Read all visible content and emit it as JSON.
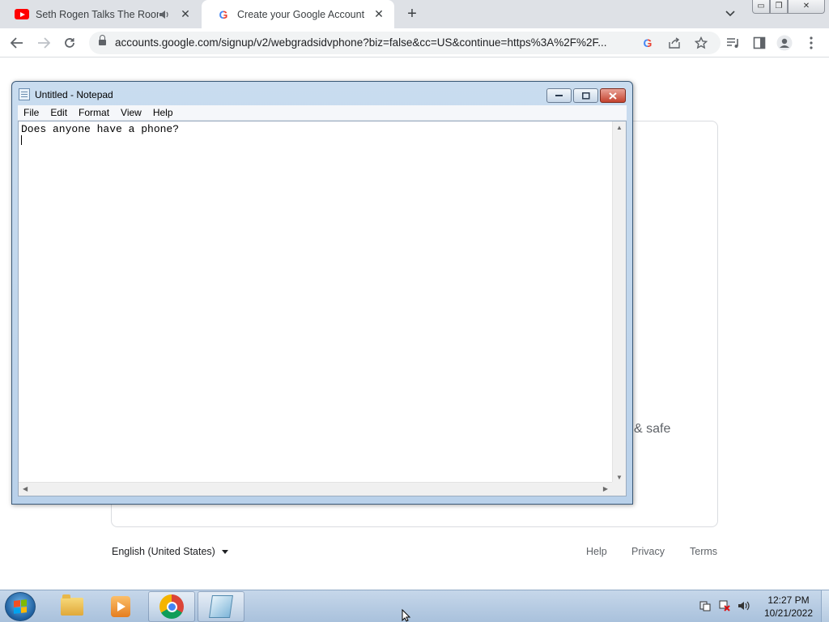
{
  "browser": {
    "tabs": [
      {
        "title": "Seth Rogen Talks The Room",
        "favicon": "youtube-icon",
        "audio_icon": "speaker-icon"
      },
      {
        "title": "Create your Google Account",
        "favicon": "google-icon"
      }
    ],
    "url": "accounts.google.com/signup/v2/webgradsidvphone?biz=false&cc=US&continue=https%3A%2F%2F...",
    "window_controls": {
      "minimize": "▭",
      "restore": "❐",
      "close": "✕"
    }
  },
  "page": {
    "partial_text": "& safe",
    "language": "English (United States)",
    "footer_links": [
      "Help",
      "Privacy",
      "Terms"
    ]
  },
  "notepad": {
    "title": "Untitled - Notepad",
    "menu": [
      "File",
      "Edit",
      "Format",
      "View",
      "Help"
    ],
    "content": "Does anyone have a phone?"
  },
  "taskbar": {
    "time": "12:27 PM",
    "date": "10/21/2022",
    "pinned": [
      "windows-explorer-icon",
      "media-player-icon",
      "chrome-icon",
      "notepad-icon"
    ]
  }
}
